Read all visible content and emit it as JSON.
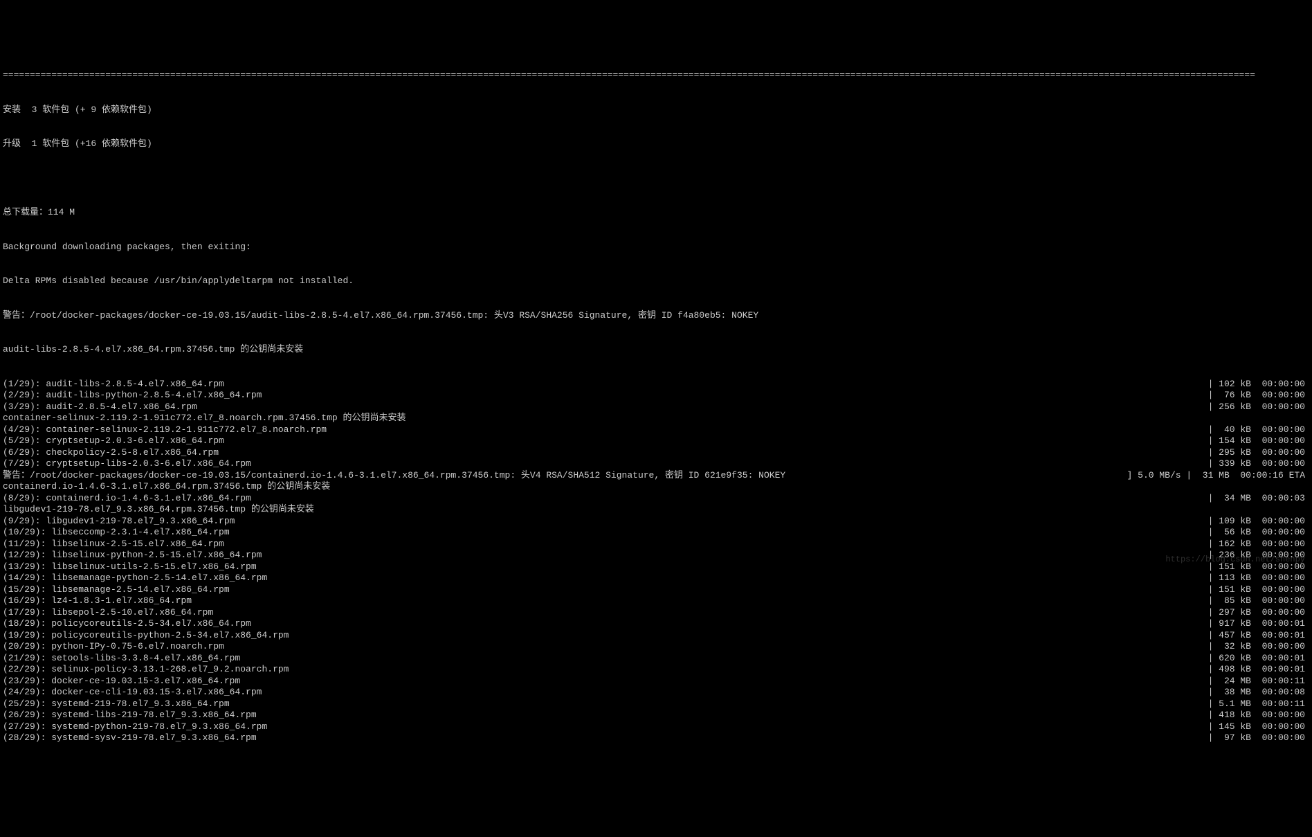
{
  "divider": "========================================================================================================================================================================================================================================",
  "header": {
    "install": "安装  3 软件包 (+ 9 依赖软件包)",
    "upgrade": "升级  1 软件包 (+16 依赖软件包)"
  },
  "summary": {
    "total": "总下载量：114 M",
    "bg": "Background downloading packages, then exiting:",
    "delta": "Delta RPMs disabled because /usr/bin/applydeltarpm not installed.",
    "warn1": "警告：/root/docker-packages/docker-ce-19.03.15/audit-libs-2.8.5-4.el7.x86_64.rpm.37456.tmp: 头V3 RSA/SHA256 Signature, 密钥 ID f4a80eb5: NOKEY",
    "key1": "audit-libs-2.8.5-4.el7.x86_64.rpm.37456.tmp 的公钥尚未安装"
  },
  "rows": [
    {
      "left": "(1/29): audit-libs-2.8.5-4.el7.x86_64.rpm",
      "right": "| 102 kB  00:00:00"
    },
    {
      "left": "(2/29): audit-libs-python-2.8.5-4.el7.x86_64.rpm",
      "right": "|  76 kB  00:00:00"
    },
    {
      "left": "(3/29): audit-2.8.5-4.el7.x86_64.rpm",
      "right": "| 256 kB  00:00:00"
    },
    {
      "left": "container-selinux-2.119.2-1.911c772.el7_8.noarch.rpm.37456.tmp 的公钥尚未安装",
      "right": ""
    },
    {
      "left": "(4/29): container-selinux-2.119.2-1.911c772.el7_8.noarch.rpm",
      "right": "|  40 kB  00:00:00"
    },
    {
      "left": "(5/29): cryptsetup-2.0.3-6.el7.x86_64.rpm",
      "right": "| 154 kB  00:00:00"
    },
    {
      "left": "(6/29): checkpolicy-2.5-8.el7.x86_64.rpm",
      "right": "| 295 kB  00:00:00"
    },
    {
      "left": "(7/29): cryptsetup-libs-2.0.3-6.el7.x86_64.rpm",
      "right": "| 339 kB  00:00:00"
    },
    {
      "left": "警告：/root/docker-packages/docker-ce-19.03.15/containerd.io-1.4.6-3.1.el7.x86_64.rpm.37456.tmp: 头V4 RSA/SHA512 Signature, 密钥 ID 621e9f35: NOKEY",
      "right": "] 5.0 MB/s |  31 MB  00:00:16 ETA"
    },
    {
      "left": "containerd.io-1.4.6-3.1.el7.x86_64.rpm.37456.tmp 的公钥尚未安装",
      "right": ""
    },
    {
      "left": "(8/29): containerd.io-1.4.6-3.1.el7.x86_64.rpm",
      "right": "|  34 MB  00:00:03"
    },
    {
      "left": "libgudev1-219-78.el7_9.3.x86_64.rpm.37456.tmp 的公钥尚未安装",
      "right": ""
    },
    {
      "left": "(9/29): libgudev1-219-78.el7_9.3.x86_64.rpm",
      "right": "| 109 kB  00:00:00"
    },
    {
      "left": "(10/29): libseccomp-2.3.1-4.el7.x86_64.rpm",
      "right": "|  56 kB  00:00:00"
    },
    {
      "left": "(11/29): libselinux-2.5-15.el7.x86_64.rpm",
      "right": "| 162 kB  00:00:00"
    },
    {
      "left": "(12/29): libselinux-python-2.5-15.el7.x86_64.rpm",
      "right": "| 236 kB  00:00:00"
    },
    {
      "left": "(13/29): libselinux-utils-2.5-15.el7.x86_64.rpm",
      "right": "| 151 kB  00:00:00"
    },
    {
      "left": "(14/29): libsemanage-python-2.5-14.el7.x86_64.rpm",
      "right": "| 113 kB  00:00:00"
    },
    {
      "left": "(15/29): libsemanage-2.5-14.el7.x86_64.rpm",
      "right": "| 151 kB  00:00:00"
    },
    {
      "left": "(16/29): lz4-1.8.3-1.el7.x86_64.rpm",
      "right": "|  85 kB  00:00:00"
    },
    {
      "left": "(17/29): libsepol-2.5-10.el7.x86_64.rpm",
      "right": "| 297 kB  00:00:00"
    },
    {
      "left": "(18/29): policycoreutils-2.5-34.el7.x86_64.rpm",
      "right": "| 917 kB  00:00:01"
    },
    {
      "left": "(19/29): policycoreutils-python-2.5-34.el7.x86_64.rpm",
      "right": "| 457 kB  00:00:01"
    },
    {
      "left": "(20/29): python-IPy-0.75-6.el7.noarch.rpm",
      "right": "|  32 kB  00:00:00"
    },
    {
      "left": "(21/29): setools-libs-3.3.8-4.el7.x86_64.rpm",
      "right": "| 620 kB  00:00:01"
    },
    {
      "left": "(22/29): selinux-policy-3.13.1-268.el7_9.2.noarch.rpm",
      "right": "| 498 kB  00:00:01"
    },
    {
      "left": "(23/29): docker-ce-19.03.15-3.el7.x86_64.rpm",
      "right": "|  24 MB  00:00:11"
    },
    {
      "left": "(24/29): docker-ce-cli-19.03.15-3.el7.x86_64.rpm",
      "right": "|  38 MB  00:00:08"
    },
    {
      "left": "(25/29): systemd-219-78.el7_9.3.x86_64.rpm",
      "right": "| 5.1 MB  00:00:11"
    },
    {
      "left": "(26/29): systemd-libs-219-78.el7_9.3.x86_64.rpm",
      "right": "| 418 kB  00:00:00"
    },
    {
      "left": "(27/29): systemd-python-219-78.el7_9.3.x86_64.rpm",
      "right": "| 145 kB  00:00:00"
    },
    {
      "left": "(28/29): systemd-sysv-219-78.el7_9.3.x86_64.rpm",
      "right": "|  97 kB  00:00:00"
    }
  ],
  "watermark": "https://blog.csdn.net/shenpy"
}
